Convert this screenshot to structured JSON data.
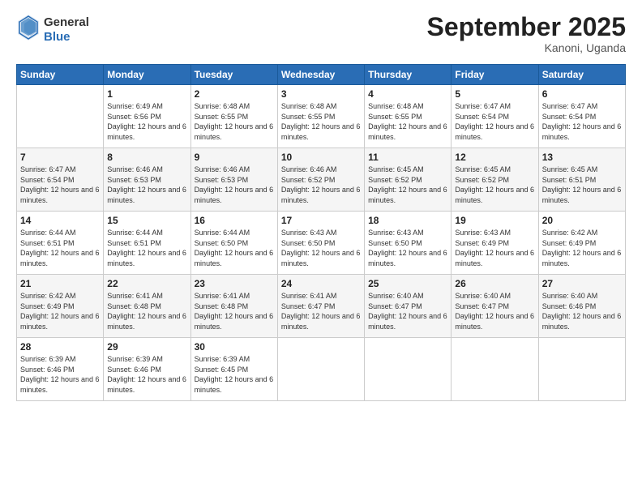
{
  "header": {
    "logo_line1": "General",
    "logo_line2": "Blue",
    "month_title": "September 2025",
    "location": "Kanoni, Uganda"
  },
  "days_of_week": [
    "Sunday",
    "Monday",
    "Tuesday",
    "Wednesday",
    "Thursday",
    "Friday",
    "Saturday"
  ],
  "weeks": [
    [
      {
        "day": "",
        "sunrise": "",
        "sunset": "",
        "daylight": ""
      },
      {
        "day": "1",
        "sunrise": "Sunrise: 6:49 AM",
        "sunset": "Sunset: 6:56 PM",
        "daylight": "Daylight: 12 hours and 6 minutes."
      },
      {
        "day": "2",
        "sunrise": "Sunrise: 6:48 AM",
        "sunset": "Sunset: 6:55 PM",
        "daylight": "Daylight: 12 hours and 6 minutes."
      },
      {
        "day": "3",
        "sunrise": "Sunrise: 6:48 AM",
        "sunset": "Sunset: 6:55 PM",
        "daylight": "Daylight: 12 hours and 6 minutes."
      },
      {
        "day": "4",
        "sunrise": "Sunrise: 6:48 AM",
        "sunset": "Sunset: 6:55 PM",
        "daylight": "Daylight: 12 hours and 6 minutes."
      },
      {
        "day": "5",
        "sunrise": "Sunrise: 6:47 AM",
        "sunset": "Sunset: 6:54 PM",
        "daylight": "Daylight: 12 hours and 6 minutes."
      },
      {
        "day": "6",
        "sunrise": "Sunrise: 6:47 AM",
        "sunset": "Sunset: 6:54 PM",
        "daylight": "Daylight: 12 hours and 6 minutes."
      }
    ],
    [
      {
        "day": "7",
        "sunrise": "Sunrise: 6:47 AM",
        "sunset": "Sunset: 6:54 PM",
        "daylight": "Daylight: 12 hours and 6 minutes."
      },
      {
        "day": "8",
        "sunrise": "Sunrise: 6:46 AM",
        "sunset": "Sunset: 6:53 PM",
        "daylight": "Daylight: 12 hours and 6 minutes."
      },
      {
        "day": "9",
        "sunrise": "Sunrise: 6:46 AM",
        "sunset": "Sunset: 6:53 PM",
        "daylight": "Daylight: 12 hours and 6 minutes."
      },
      {
        "day": "10",
        "sunrise": "Sunrise: 6:46 AM",
        "sunset": "Sunset: 6:52 PM",
        "daylight": "Daylight: 12 hours and 6 minutes."
      },
      {
        "day": "11",
        "sunrise": "Sunrise: 6:45 AM",
        "sunset": "Sunset: 6:52 PM",
        "daylight": "Daylight: 12 hours and 6 minutes."
      },
      {
        "day": "12",
        "sunrise": "Sunrise: 6:45 AM",
        "sunset": "Sunset: 6:52 PM",
        "daylight": "Daylight: 12 hours and 6 minutes."
      },
      {
        "day": "13",
        "sunrise": "Sunrise: 6:45 AM",
        "sunset": "Sunset: 6:51 PM",
        "daylight": "Daylight: 12 hours and 6 minutes."
      }
    ],
    [
      {
        "day": "14",
        "sunrise": "Sunrise: 6:44 AM",
        "sunset": "Sunset: 6:51 PM",
        "daylight": "Daylight: 12 hours and 6 minutes."
      },
      {
        "day": "15",
        "sunrise": "Sunrise: 6:44 AM",
        "sunset": "Sunset: 6:51 PM",
        "daylight": "Daylight: 12 hours and 6 minutes."
      },
      {
        "day": "16",
        "sunrise": "Sunrise: 6:44 AM",
        "sunset": "Sunset: 6:50 PM",
        "daylight": "Daylight: 12 hours and 6 minutes."
      },
      {
        "day": "17",
        "sunrise": "Sunrise: 6:43 AM",
        "sunset": "Sunset: 6:50 PM",
        "daylight": "Daylight: 12 hours and 6 minutes."
      },
      {
        "day": "18",
        "sunrise": "Sunrise: 6:43 AM",
        "sunset": "Sunset: 6:50 PM",
        "daylight": "Daylight: 12 hours and 6 minutes."
      },
      {
        "day": "19",
        "sunrise": "Sunrise: 6:43 AM",
        "sunset": "Sunset: 6:49 PM",
        "daylight": "Daylight: 12 hours and 6 minutes."
      },
      {
        "day": "20",
        "sunrise": "Sunrise: 6:42 AM",
        "sunset": "Sunset: 6:49 PM",
        "daylight": "Daylight: 12 hours and 6 minutes."
      }
    ],
    [
      {
        "day": "21",
        "sunrise": "Sunrise: 6:42 AM",
        "sunset": "Sunset: 6:49 PM",
        "daylight": "Daylight: 12 hours and 6 minutes."
      },
      {
        "day": "22",
        "sunrise": "Sunrise: 6:41 AM",
        "sunset": "Sunset: 6:48 PM",
        "daylight": "Daylight: 12 hours and 6 minutes."
      },
      {
        "day": "23",
        "sunrise": "Sunrise: 6:41 AM",
        "sunset": "Sunset: 6:48 PM",
        "daylight": "Daylight: 12 hours and 6 minutes."
      },
      {
        "day": "24",
        "sunrise": "Sunrise: 6:41 AM",
        "sunset": "Sunset: 6:47 PM",
        "daylight": "Daylight: 12 hours and 6 minutes."
      },
      {
        "day": "25",
        "sunrise": "Sunrise: 6:40 AM",
        "sunset": "Sunset: 6:47 PM",
        "daylight": "Daylight: 12 hours and 6 minutes."
      },
      {
        "day": "26",
        "sunrise": "Sunrise: 6:40 AM",
        "sunset": "Sunset: 6:47 PM",
        "daylight": "Daylight: 12 hours and 6 minutes."
      },
      {
        "day": "27",
        "sunrise": "Sunrise: 6:40 AM",
        "sunset": "Sunset: 6:46 PM",
        "daylight": "Daylight: 12 hours and 6 minutes."
      }
    ],
    [
      {
        "day": "28",
        "sunrise": "Sunrise: 6:39 AM",
        "sunset": "Sunset: 6:46 PM",
        "daylight": "Daylight: 12 hours and 6 minutes."
      },
      {
        "day": "29",
        "sunrise": "Sunrise: 6:39 AM",
        "sunset": "Sunset: 6:46 PM",
        "daylight": "Daylight: 12 hours and 6 minutes."
      },
      {
        "day": "30",
        "sunrise": "Sunrise: 6:39 AM",
        "sunset": "Sunset: 6:45 PM",
        "daylight": "Daylight: 12 hours and 6 minutes."
      },
      {
        "day": "",
        "sunrise": "",
        "sunset": "",
        "daylight": ""
      },
      {
        "day": "",
        "sunrise": "",
        "sunset": "",
        "daylight": ""
      },
      {
        "day": "",
        "sunrise": "",
        "sunset": "",
        "daylight": ""
      },
      {
        "day": "",
        "sunrise": "",
        "sunset": "",
        "daylight": ""
      }
    ]
  ]
}
